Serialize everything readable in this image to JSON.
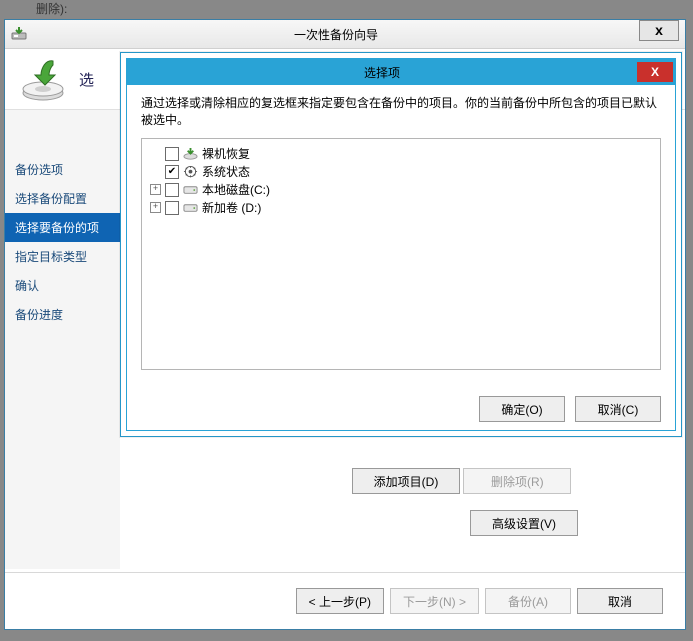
{
  "ghost_text": "删除):",
  "wizard": {
    "title": "一次性备份向导",
    "header_title": "选",
    "close_glyph": "x",
    "sidebar": {
      "steps": [
        {
          "label": "备份选项",
          "active": false
        },
        {
          "label": "选择备份配置",
          "active": false
        },
        {
          "label": "选择要备份的项",
          "active": true
        },
        {
          "label": "指定目标类型",
          "active": false
        },
        {
          "label": "确认",
          "active": false
        },
        {
          "label": "备份进度",
          "active": false
        }
      ]
    },
    "main": {
      "add_item": "添加项目(D)",
      "remove_item": "删除项(R)",
      "advanced": "高级设置(V)"
    },
    "footer": {
      "prev": "< 上一步(P)",
      "next": "下一步(N) >",
      "backup": "备份(A)",
      "cancel": "取消"
    }
  },
  "modal": {
    "title": "选择项",
    "close_glyph": "X",
    "description": "通过选择或清除相应的复选框来指定要包含在备份中的项目。你的当前备份中所包含的项目已默认被选中。",
    "tree": {
      "nodes": [
        {
          "expand": "",
          "checked": false,
          "icon": "recovery",
          "label": "裸机恢复"
        },
        {
          "expand": "",
          "checked": true,
          "icon": "system",
          "label": "系统状态"
        },
        {
          "expand": "+",
          "checked": false,
          "icon": "disk",
          "label": "本地磁盘(C:)"
        },
        {
          "expand": "+",
          "checked": false,
          "icon": "disk",
          "label": "新加卷 (D:)"
        }
      ]
    },
    "ok": "确定(O)",
    "cancel": "取消(C)"
  }
}
